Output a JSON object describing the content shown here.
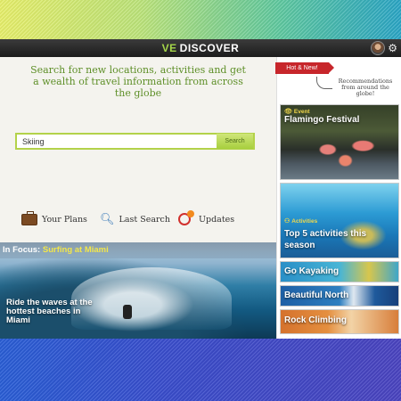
{
  "app": {
    "brand_prefix": "VE",
    "brand_name": "DISCOVER"
  },
  "main": {
    "tagline": "Search for new locations, activities and get a wealth of travel information from across the globe",
    "search": {
      "value": "Skiing",
      "button_label": "Search"
    },
    "quicklinks": {
      "plans": "Your Plans",
      "last_search": "Last Search",
      "updates": "Updates"
    },
    "in_focus": {
      "prefix": "In Focus:",
      "title": "Surfing at Miami",
      "caption": "Ride the waves at the hottest beaches in Miami"
    }
  },
  "sidebar": {
    "ribbon": "Hot & New!",
    "ribbon_caption": "Recommendations from around the globe!",
    "cards": [
      {
        "badge": "Event",
        "title": "Flamingo Festival"
      },
      {
        "badge": "Activities",
        "title": "Top 5 activities this season"
      },
      {
        "title": "Go Kayaking"
      },
      {
        "title": "Beautiful North"
      },
      {
        "title": "Rock Climbing"
      }
    ]
  },
  "colors": {
    "accent_green": "#5e8f28",
    "search_border": "#b3d24a",
    "ribbon_red": "#c7262b",
    "highlight_yellow": "#f2e64a"
  },
  "icons": {
    "settings": "gear-icon",
    "plans": "briefcase-icon",
    "last_search": "magnifier-icon",
    "updates": "updates-icon",
    "event": "eye-icon",
    "activities": "binoculars-icon"
  }
}
